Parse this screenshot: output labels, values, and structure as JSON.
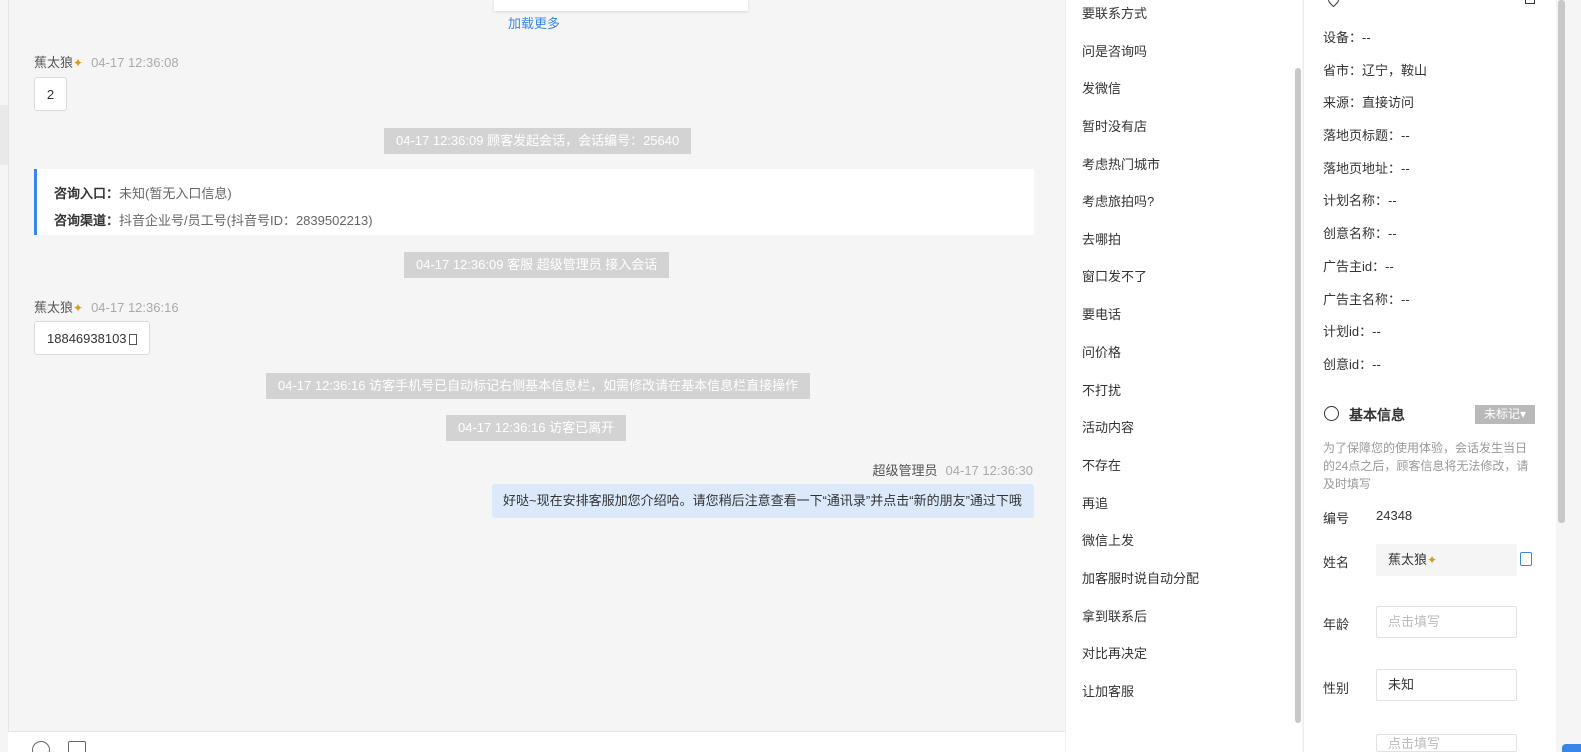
{
  "chat": {
    "load_more": "加载更多",
    "msg1": {
      "sender": "蕉太狼",
      "badge": "✦",
      "time": "04-17 12:36:08",
      "text": "2"
    },
    "sys1": "04-17 12:36:09 顾客发起会话，会话编号：25640",
    "entry": {
      "entry_label": "咨询入口：",
      "entry_value": "未知(暂无入口信息)",
      "channel_label": "咨询渠道：",
      "channel_value": "抖音企业号/员工号(抖音号ID：2839502213)"
    },
    "sys2": "04-17 12:36:09 客服 超级管理员 接入会话",
    "msg2": {
      "sender": "蕉太狼",
      "badge": "✦",
      "time": "04-17 12:36:16",
      "text": "18846938103"
    },
    "sys3": "04-17 12:36:16 访客手机号已自动标记右侧基本信息栏，如需修改请在基本信息栏直接操作",
    "sys4": "04-17 12:36:16 访客已离开",
    "agent": {
      "sender": "超级管理员",
      "time": "04-17 12:36:30",
      "text": "好哒~现在安排客服加您介绍哈。请您稍后注意查看一下“通讯录”并点击“新的朋友”通过下哦"
    }
  },
  "quick_replies": [
    "要联系方式",
    "问是咨询吗",
    "发微信",
    "暂时没有店",
    "考虑热门城市",
    "考虑旅拍吗?",
    "去哪拍",
    "窗口发不了",
    "要电话",
    "问价格",
    "不打扰",
    "活动内容",
    "不存在",
    "再追",
    "微信上发",
    "加客服时说自动分配",
    "拿到联系后",
    "对比再决定",
    "让加客服"
  ],
  "source": {
    "lines": [
      "设备：--",
      "省市：辽宁，鞍山",
      "来源：直接访问",
      "落地页标题：--",
      "落地页地址：--",
      "计划名称：--",
      "创意名称：--",
      "广告主id：--",
      "广告主名称：--",
      "计划id：--",
      "创意id：--"
    ]
  },
  "basic": {
    "title": "基本信息",
    "tag_button": "未标记▾",
    "notice": "为了保障您的使用体验，会话发生当日的24点之后，顾客信息将无法修改，请及时填写",
    "id_label": "编号",
    "id_value": "24348",
    "name_label": "姓名",
    "name_value": "蕉太狼",
    "name_badge": "✦",
    "age_label": "年龄",
    "age_placeholder": "点击填写",
    "gender_label": "性别",
    "gender_value": "未知",
    "next_placeholder": "点击填写"
  },
  "colors": {
    "accent": "#3a86e8",
    "agent_bubble": "#dbe9fb",
    "system_pill": "#d3d3d3"
  }
}
